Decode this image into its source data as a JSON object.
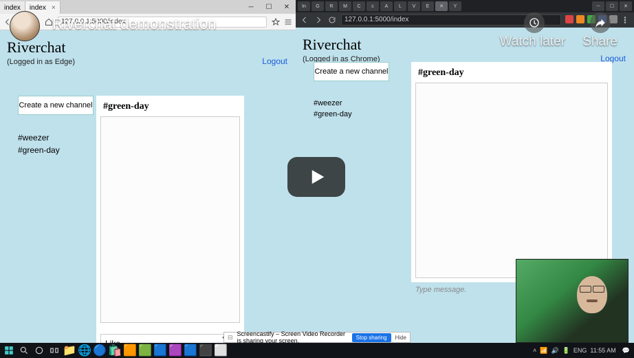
{
  "video": {
    "title": "Riverchat demonstration",
    "watch_later": "Watch later",
    "share": "Share"
  },
  "left": {
    "tabs": [
      {
        "label": "index"
      },
      {
        "label": "index"
      }
    ],
    "address": "127.0.0.1:5000/index",
    "brand": "Riverchat",
    "logged_in": "(Logged in as Edge)",
    "logout": "Logout",
    "new_channel": "Create a new channel",
    "channels": [
      "#weezer",
      "#green-day"
    ],
    "chat_title": "#green-day",
    "input_value": "Like"
  },
  "right": {
    "address": "127.0.0.1:5000/index",
    "brand": "Riverchat",
    "logged_in": "(Logged in as Chrome)",
    "logout": "Logout",
    "new_channel": "Create a new channel",
    "channels": [
      "#weezer",
      "#green-day"
    ],
    "chat_title": "#green-day",
    "msg_placeholder": "Type message."
  },
  "banner": {
    "text": "Screencastify – Screen Video Recorder is sharing your screen.",
    "stop": "Stop sharing",
    "hide": "Hide"
  },
  "taskbar": {
    "lang": "ENG",
    "time": "11:55 AM"
  }
}
